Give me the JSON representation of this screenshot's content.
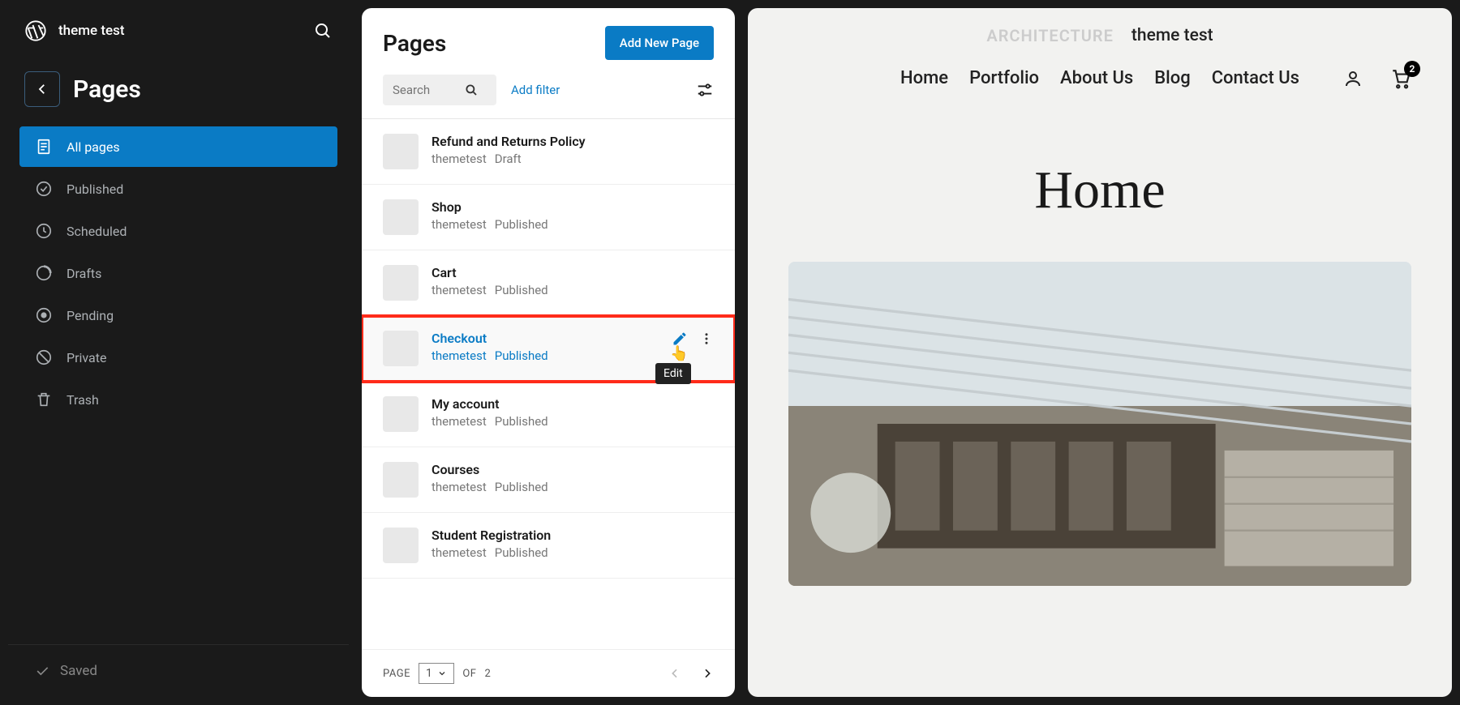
{
  "top": {
    "site_name": "theme test"
  },
  "section": {
    "title": "Pages"
  },
  "nav": [
    {
      "label": "All pages",
      "active": true,
      "icon": "pages"
    },
    {
      "label": "Published",
      "active": false,
      "icon": "check"
    },
    {
      "label": "Scheduled",
      "active": false,
      "icon": "clock"
    },
    {
      "label": "Drafts",
      "active": false,
      "icon": "draft"
    },
    {
      "label": "Pending",
      "active": false,
      "icon": "pending"
    },
    {
      "label": "Private",
      "active": false,
      "icon": "private"
    },
    {
      "label": "Trash",
      "active": false,
      "icon": "trash"
    }
  ],
  "saved_label": "Saved",
  "pages_panel": {
    "title": "Pages",
    "add_button": "Add New Page",
    "search_placeholder": "Search",
    "add_filter": "Add filter",
    "tooltip": "Edit",
    "pagination": {
      "prefix": "PAGE",
      "current": "1",
      "of_label": "OF",
      "total": "2"
    }
  },
  "pages": [
    {
      "title": "Refund and Returns Policy",
      "author": "themetest",
      "status": "Draft",
      "highlighted": false,
      "active": false
    },
    {
      "title": "Shop",
      "author": "themetest",
      "status": "Published",
      "highlighted": false,
      "active": false
    },
    {
      "title": "Cart",
      "author": "themetest",
      "status": "Published",
      "highlighted": false,
      "active": false
    },
    {
      "title": "Checkout",
      "author": "themetest",
      "status": "Published",
      "highlighted": true,
      "active": true
    },
    {
      "title": "My account",
      "author": "themetest",
      "status": "Published",
      "highlighted": false,
      "active": false
    },
    {
      "title": "Courses",
      "author": "themetest",
      "status": "Published",
      "highlighted": false,
      "active": false
    },
    {
      "title": "Student Registration",
      "author": "themetest",
      "status": "Published",
      "highlighted": false,
      "active": false
    }
  ],
  "preview": {
    "brand": "ARCHITECTURE",
    "site": "theme test",
    "nav": [
      "Home",
      "Portfolio",
      "About Us",
      "Blog",
      "Contact Us"
    ],
    "cart_count": "2",
    "hero_title": "Home"
  }
}
